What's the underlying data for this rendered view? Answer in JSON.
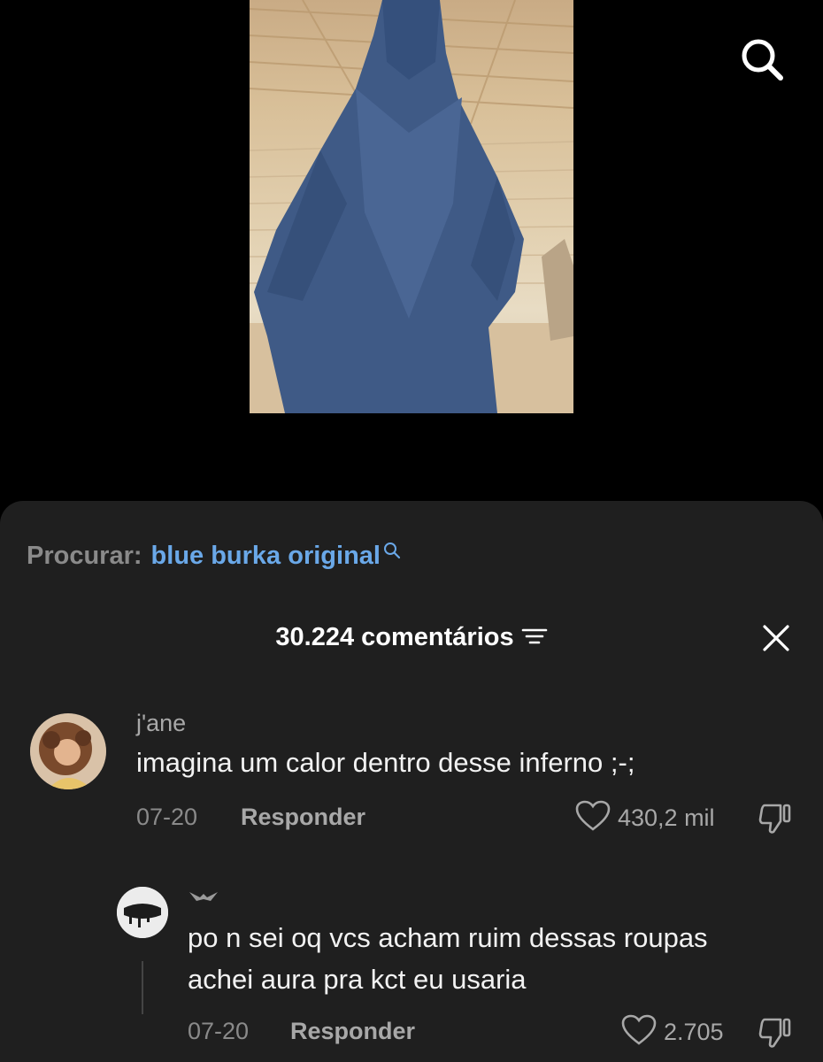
{
  "video": {
    "search_icon": "search-icon",
    "thumbnail": "video-frame-blue-burka"
  },
  "related_search": {
    "label": "Procurar:",
    "query": "blue burka original",
    "icon": "mini-search-icon"
  },
  "comments_header": {
    "count_label": "30.224 comentários",
    "filter_icon": "filter-icon",
    "close_icon": "close-icon"
  },
  "comments": [
    {
      "username": "j'ane",
      "text": "imagina um calor dentro desse inferno ;-;",
      "date": "07-20",
      "reply_label": "Responder",
      "likes": "430,2 mil"
    }
  ],
  "replies": [
    {
      "text": "po n sei oq vcs acham ruim dessas roupas achei aura pra kct eu usaria",
      "date": "07-20",
      "reply_label": "Responder",
      "likes": "2.705"
    }
  ],
  "colors": {
    "sheet_bg": "#1f1f1f",
    "link_blue": "#6aa8e8",
    "burka_blue": "#3f5a86"
  }
}
